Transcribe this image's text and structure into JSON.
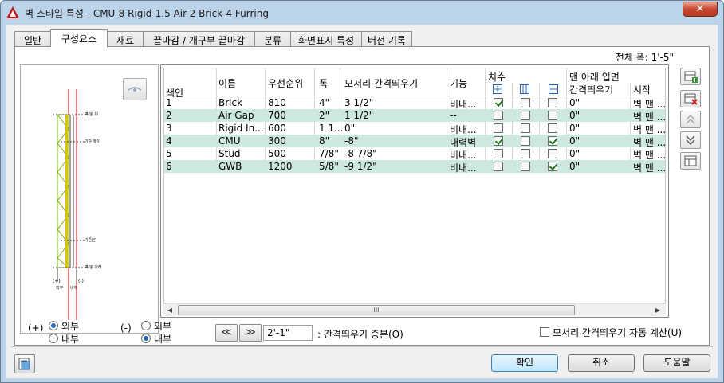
{
  "window": {
    "title": "벽 스타일 특성 - CMU-8 Rigid-1.5 Air-2 Brick-4 Furring",
    "close_label": "✕"
  },
  "tabs": [
    {
      "label": "일반"
    },
    {
      "label": "구성요소"
    },
    {
      "label": "재료"
    },
    {
      "label": "끝마감 / 개구부 끝마감"
    },
    {
      "label": "분류"
    },
    {
      "label": "화면표시 특성"
    },
    {
      "label": "버전 기록"
    }
  ],
  "total_width": "전체 폭: 1'-5\"",
  "preview": {
    "labels": [
      "벽 맨 위",
      "기준 높이",
      "기준선",
      "벽 맨 아래"
    ],
    "plus_label": "(+)",
    "minus_label": "(-)",
    "outside_short": "외부",
    "inside_short": "내부"
  },
  "grid": {
    "group_headers": {
      "dimension": "치수",
      "bottom_elevation": "맨 아래 입면"
    },
    "columns": {
      "index": "색인",
      "name": "이름",
      "priority": "우선순위",
      "width": "폭",
      "edge_offset": "모서리 간격띄우기",
      "function": "기능",
      "offset": "간격띄우기",
      "from": "시작"
    },
    "rows": [
      {
        "index": "1",
        "name": "Brick",
        "priority": "810",
        "width": "4\"",
        "edge_offset": "3 1/2\"",
        "function": "비내...",
        "c1": true,
        "c2": false,
        "c3": false,
        "offset": "0\"",
        "from": "벽 맨 ...",
        "green": false
      },
      {
        "index": "2",
        "name": "Air Gap",
        "priority": "700",
        "width": "2\"",
        "edge_offset": "1 1/2\"",
        "function": "--",
        "c1": false,
        "c2": false,
        "c3": false,
        "offset": "0\"",
        "from": "벽 맨 ...",
        "green": true
      },
      {
        "index": "3",
        "name": "Rigid In...",
        "priority": "600",
        "width": "1 1...",
        "edge_offset": "0\"",
        "function": "비내...",
        "c1": false,
        "c2": false,
        "c3": false,
        "offset": "0\"",
        "from": "벽 맨 ...",
        "green": false
      },
      {
        "index": "4",
        "name": "CMU",
        "priority": "300",
        "width": "8\"",
        "edge_offset": "-8\"",
        "function": "내력벽",
        "c1": true,
        "c2": false,
        "c3": true,
        "offset": "0\"",
        "from": "벽 맨 ...",
        "green": true
      },
      {
        "index": "5",
        "name": "Stud",
        "priority": "500",
        "width": "7/8\"",
        "edge_offset": "-8 7/8\"",
        "function": "비내...",
        "c1": false,
        "c2": false,
        "c3": false,
        "offset": "0\"",
        "from": "벽 맨 ...",
        "green": false
      },
      {
        "index": "6",
        "name": "GWB",
        "priority": "1200",
        "width": "5/8\"",
        "edge_offset": "-9 1/2\"",
        "function": "비내...",
        "c1": false,
        "c2": false,
        "c3": true,
        "offset": "0\"",
        "from": "벽 맨 ...",
        "green": true
      }
    ],
    "scroll_left": "◀",
    "scroll_right": "▶",
    "scroll_grip": "III"
  },
  "bottom": {
    "plus_label": "(+)",
    "minus_label": "(-)",
    "outside": "외부",
    "inside": "내부",
    "prev_label": "≪",
    "next_label": "≫",
    "offset_increment_value": "2'-1\"",
    "offset_increment_label": ": 간격띄우기 증분(O)",
    "auto_calc_label": "모서리 간격띄우기 자동 계산(U)"
  },
  "buttons": {
    "ok": "확인",
    "cancel": "취소",
    "help": "도움말"
  },
  "colors": {
    "title_bar": "#bcd4ea",
    "green_row": "#cde8dc",
    "wall_line": "#d40000",
    "insulation": "#7ab800"
  }
}
